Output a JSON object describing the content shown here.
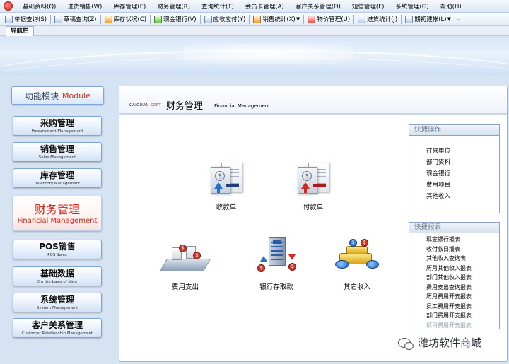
{
  "menubar": {
    "items": [
      "基础资料(Q)",
      "进货销售(W)",
      "库存管理(E)",
      "财务管理(R)",
      "查询统计(T)",
      "会员卡管理(A)",
      "客户关系管理(D)",
      "短信管理(F)",
      "系统管理(G)",
      "帮助(H)"
    ]
  },
  "toolbar": {
    "buttons": [
      "单据查询(S)",
      "草稿查询(Z)",
      "库存状况(C)",
      "现金银行(V)",
      "应收应付(Y)",
      "销售统计(X)",
      "物价管理(U)",
      "进货统计(J)",
      "期初建帐(L)"
    ]
  },
  "navtab": {
    "label": "导航栏"
  },
  "modules": {
    "header_cn": "功能模块",
    "header_en": "Module",
    "items": [
      {
        "cn": "采购管理",
        "en": "Procurement Management"
      },
      {
        "cn": "销售管理",
        "en": "Sales Management"
      },
      {
        "cn": "库存管理",
        "en": "Inventory Management"
      },
      {
        "cn": "财务管理",
        "en": "Financial Management"
      },
      {
        "cn": "POS销售",
        "en": "POS Sales"
      },
      {
        "cn": "基础数据",
        "en": "On the basis of data"
      },
      {
        "cn": "系统管理",
        "en": "System Management"
      },
      {
        "cn": "客户关系管理",
        "en": "Customer Relationship Management"
      }
    ]
  },
  "content": {
    "brand_main": "CAIQUAN",
    "brand_soft": "SOFT",
    "title_cn": "财务管理",
    "title_en": "Financial Management",
    "functions": {
      "receipt": "收款单",
      "payment": "付款单",
      "expense": "费用支出",
      "bank": "银行存取款",
      "other_income": "其它收入"
    }
  },
  "quick_ops": {
    "title": "快捷操作",
    "items": [
      "往来单位",
      "部门资料",
      "现金银行",
      "费用项目",
      "其他收入"
    ]
  },
  "quick_reports": {
    "title": "快捷报表",
    "items": [
      "现金银行报表",
      "收付款日报表",
      "其他收入查询表",
      "历月其他收入报表",
      "部门其他收入报表",
      "费用支出查询报表",
      "历月费用开支报表",
      "员工费用开支报表",
      "部门费用开支报表",
      "项目费用开支报表"
    ]
  },
  "watermark": {
    "text": "潍坊软件商城"
  }
}
